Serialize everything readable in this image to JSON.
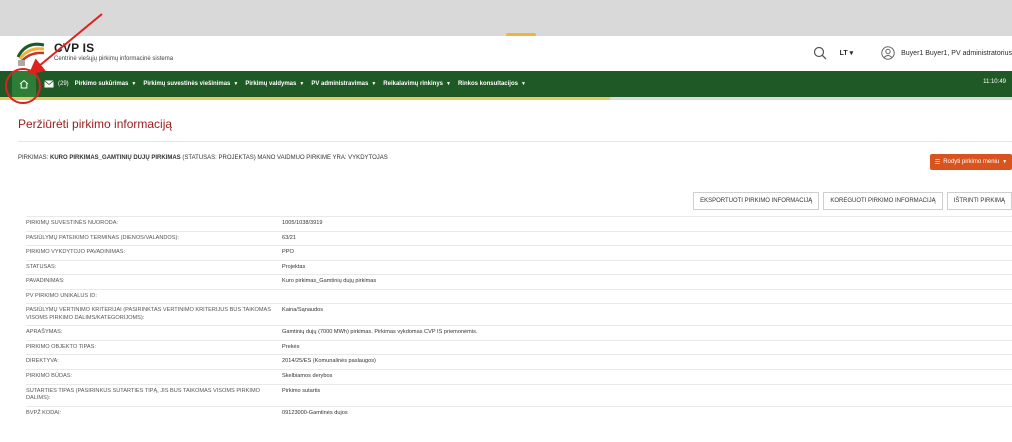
{
  "header": {
    "brand_title": "CVP IS",
    "brand_subtitle": "Centrinė viešųjų pirkimų informacinė sistema",
    "language": "LT",
    "user": "Buyer1 Buyer1, PV administratorius"
  },
  "nav": {
    "message_count": "(29)",
    "items": [
      "Pirkimo sukūrimas",
      "Pirkimų suvestinės viešinimas",
      "Pirkimų valdymas",
      "PV administravimas",
      "Reikalavimų rinkinys",
      "Rinkos konsultacijos"
    ],
    "clock": "11:10:49"
  },
  "page": {
    "title": "Peržiūrėti pirkimo informaciją"
  },
  "procurement": {
    "prefix": "PIRKIMAS:",
    "name": "KURO PIRKIMAS_GAMTINIŲ DUJŲ PIRKIMAS",
    "status_text": "(STATUSAS: PROJEKTAS)",
    "role_text": "MANO VAIDMUO PIRKIME YRA: VYKDYTOJAS",
    "menu_button": "Rodyti pirkimo meniu"
  },
  "actions": {
    "export": "EKSPORTUOTI PIRKIMO INFORMACIJĄ",
    "edit": "KOREGUOTI PIRKIMO INFORMACIJĄ",
    "delete": "IŠTRINTI PIRKIMĄ"
  },
  "details": [
    {
      "label": "PIRKIMŲ SUVESTINĖS NUORODA:",
      "value": "1005/1038/3919"
    },
    {
      "label": "PASIŪLYMŲ PATEIKIMO TERMINAS (DIENOS/VALANDOS):",
      "value": "63/21"
    },
    {
      "label": "PIRKIMO VYKDYTOJO PAVADINIMAS:",
      "value": "PPO"
    },
    {
      "label": "STATUSAS:",
      "value": "Projektas"
    },
    {
      "label": "PAVADINIMAS:",
      "value": "Kuro pirkimas_Gamtinių dujų pirkimas"
    },
    {
      "label": "PV PIRKIMO UNIKALUS ID:",
      "value": ""
    },
    {
      "label": "PASIŪLYMŲ VERTINIMO KRITERIJAI (PASIRINKTAS VERTINIMO KRITERIJUS BUS TAIKOMAS VISOMS PIRKIMO DALIMS/KATEGORIJOMS):",
      "value": "Kaina/Sąnaudos"
    },
    {
      "label": "APRAŠYMAS:",
      "value": "Gamtinių dujų (7000 MWh) pirkimas. Pirkimas vykdomas CVP IS priemonėmis."
    },
    {
      "label": "PIRKIMO OBJEKTO TIPAS:",
      "value": "Prekės"
    },
    {
      "label": "DIREKTYVA:",
      "value": "2014/25/ES (Komunalinės paslaugos)"
    },
    {
      "label": "PIRKIMO BŪDAS:",
      "value": "Skelbiamos derybos"
    },
    {
      "label": "SUTARTIES TIPAS (PASIRINKUS SUTARTIES TIPĄ, JIS BUS TAIKOMAS VISOMS PIRKIMO DALIMS):",
      "value": "Pirkimo sutartis"
    },
    {
      "label": "BVPŽ KODAI:",
      "value": "09123000-Gamtinės dujos"
    }
  ],
  "colors": {
    "nav_bg": "#1f5a26",
    "title": "#9b1c1c",
    "menu_button": "#d9531e",
    "annotation": "#e0201c"
  }
}
